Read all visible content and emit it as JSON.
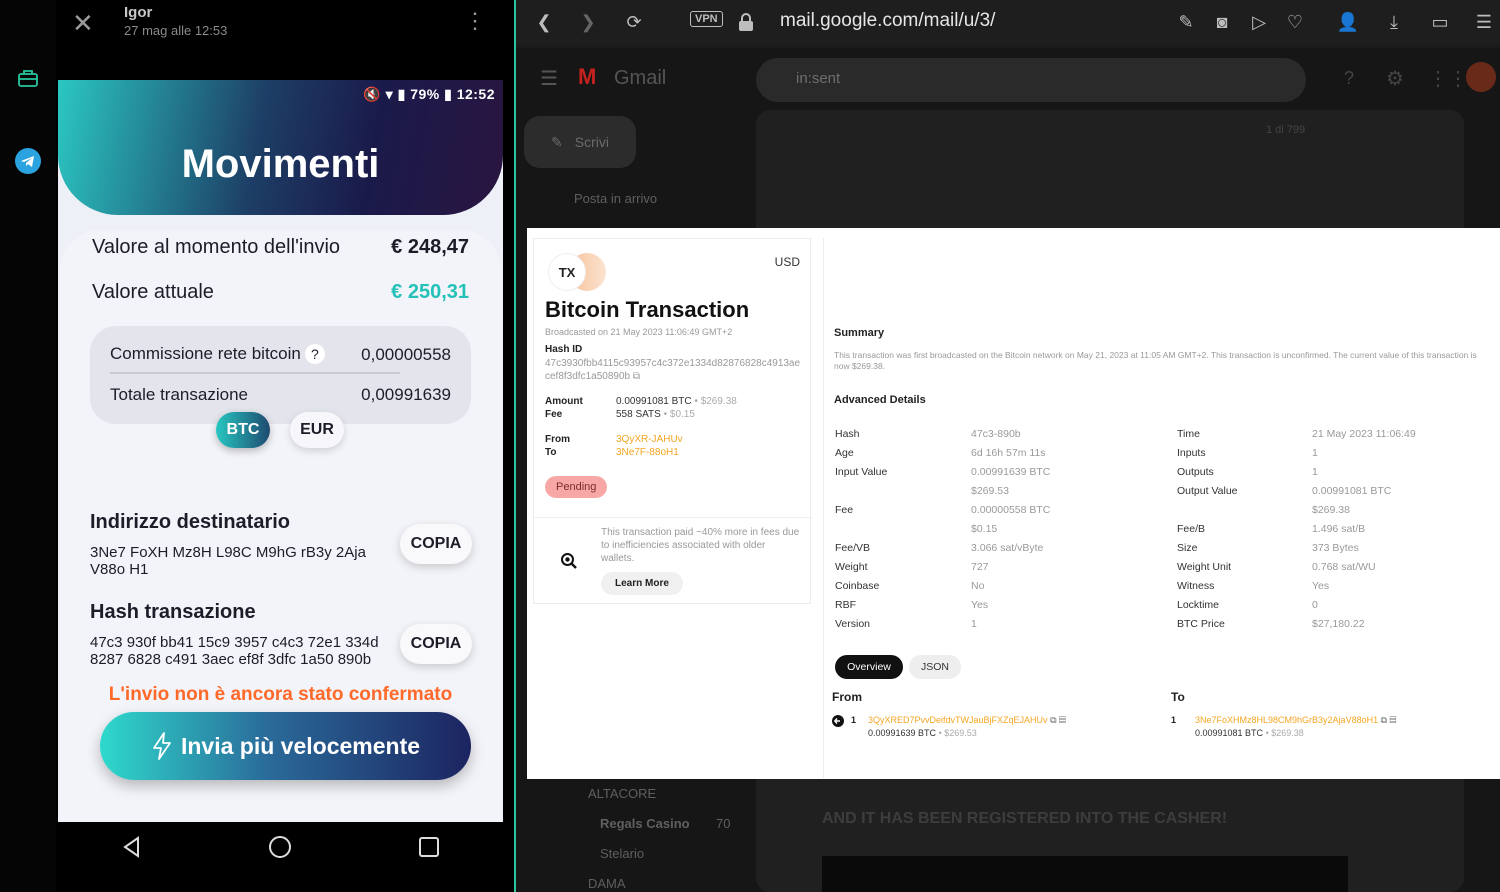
{
  "viewer": {
    "name": "Igor",
    "date": "27 mag alle 12:53"
  },
  "phone": {
    "status": "79% ▮ 12:52",
    "title": "Movimenti",
    "value_sent_label": "Valore al momento dell'invio",
    "value_sent": "€ 248,47",
    "value_current_label": "Valore attuale",
    "value_current": "€ 250,31",
    "fee_label": "Commissione rete bitcoin",
    "fee_help": "?",
    "fee_value": "0,00000558",
    "total_label": "Totale transazione",
    "total_value": "0,00991639",
    "btc_label": "BTC",
    "eur_label": "EUR",
    "dest_title": "Indirizzo destinatario",
    "dest_address": "3Ne7 FoXH Mz8H L98C M9hG rB3y 2Aja V88o H1",
    "copy_label": "COPIA",
    "hash_title": "Hash transazione",
    "hash_value": "47c3 930f bb41 15c9 3957 c4c3 72e1 334d 8287 6828 c491 3aec ef8f 3dfc 1a50 890b",
    "warning": "L'invio non è ancora stato confermato",
    "boost_label": "Invia più velocemente"
  },
  "browser": {
    "vpn": "VPN",
    "url": "mail.google.com/mail/u/3/"
  },
  "gmail": {
    "logo": "Gmail",
    "search": "in:sent",
    "compose": "Scrivi",
    "inbox": "Posta in arrivo",
    "folders": [
      {
        "label": "ALTACORE",
        "count": ""
      },
      {
        "label": "Regals Casino",
        "count": "70"
      },
      {
        "label": "Stelario",
        "count": ""
      },
      {
        "label": "DAMA",
        "count": ""
      }
    ],
    "pager": "1 di 799",
    "body_text": "AND IT HAS BEEN REGISTERED INTO THE CASHER!"
  },
  "tx": {
    "logo": "TX",
    "currency": "USD",
    "title": "Bitcoin Transaction",
    "broadcast": "Broadcasted on 21 May 2023 11:06:49 GMT+2",
    "hash_label": "Hash ID",
    "hash": "47c3930fbb4115c93957c4c372e1334d82876828c4913aecef8f3dfc1a50890b",
    "amount_label": "Amount",
    "amount_btc": "0.00991081 BTC",
    "amount_usd": "$269.38",
    "fee_label": "Fee",
    "fee_sats": "558 SATS",
    "fee_usd": "$0.15",
    "from_label": "From",
    "from": "3QyXR-JAHUv",
    "to_label": "To",
    "to": "3Ne7F-88oH1",
    "status": "Pending",
    "tip": "This transaction paid ~40% more in fees due to inefficiencies associated with older wallets.",
    "learn_more": "Learn More",
    "summary_title": "Summary",
    "summary": "This transaction was first broadcasted on the Bitcoin network on May 21, 2023 at 11:05 AM GMT+2. This transaction is unconfirmed. The current value of this transaction is now $269.38.",
    "advanced_title": "Advanced Details",
    "left_details": [
      {
        "label": "Hash",
        "value": "47c3-890b"
      },
      {
        "label": "Age",
        "value": "6d 16h 57m 11s"
      },
      {
        "label": "Input Value",
        "value": "0.00991639 BTC"
      },
      {
        "label": "",
        "value": "$269.53"
      },
      {
        "label": "Fee",
        "value": "0.00000558 BTC"
      },
      {
        "label": "",
        "value": "$0.15"
      },
      {
        "label": "Fee/VB",
        "value": "3.066 sat/vByte"
      },
      {
        "label": "Weight",
        "value": "727"
      },
      {
        "label": "Coinbase",
        "value": "No"
      },
      {
        "label": "RBF",
        "value": "Yes"
      },
      {
        "label": "Version",
        "value": "1"
      }
    ],
    "right_details": [
      {
        "label": "Time",
        "value": "21 May 2023 11:06:49"
      },
      {
        "label": "Inputs",
        "value": "1"
      },
      {
        "label": "Outputs",
        "value": "1"
      },
      {
        "label": "Output Value",
        "value": "0.00991081 BTC"
      },
      {
        "label": "",
        "value": "$269.38"
      },
      {
        "label": "Fee/B",
        "value": "1.496 sat/B"
      },
      {
        "label": "Size",
        "value": "373 Bytes"
      },
      {
        "label": "Weight Unit",
        "value": "0.768 sat/WU"
      },
      {
        "label": "Witness",
        "value": "Yes"
      },
      {
        "label": "Locktime",
        "value": "0"
      },
      {
        "label": "BTC Price",
        "value": "$27,180.22"
      }
    ],
    "tab_overview": "Overview",
    "tab_json": "JSON",
    "from_title": "From",
    "to_title": "To",
    "input_index": "1",
    "input_address": "3QyXRED7PvvDeifdvTWJauBjFXZqEJAHUv",
    "input_amount": "0.00991639 BTC",
    "input_usd": "$269.53",
    "output_index": "1",
    "output_address": "3Ne7FoXHMz8HL98CM9hGrB3y2AjaV88oH1",
    "output_amount": "0.00991081 BTC",
    "output_usd": "$269.38"
  }
}
